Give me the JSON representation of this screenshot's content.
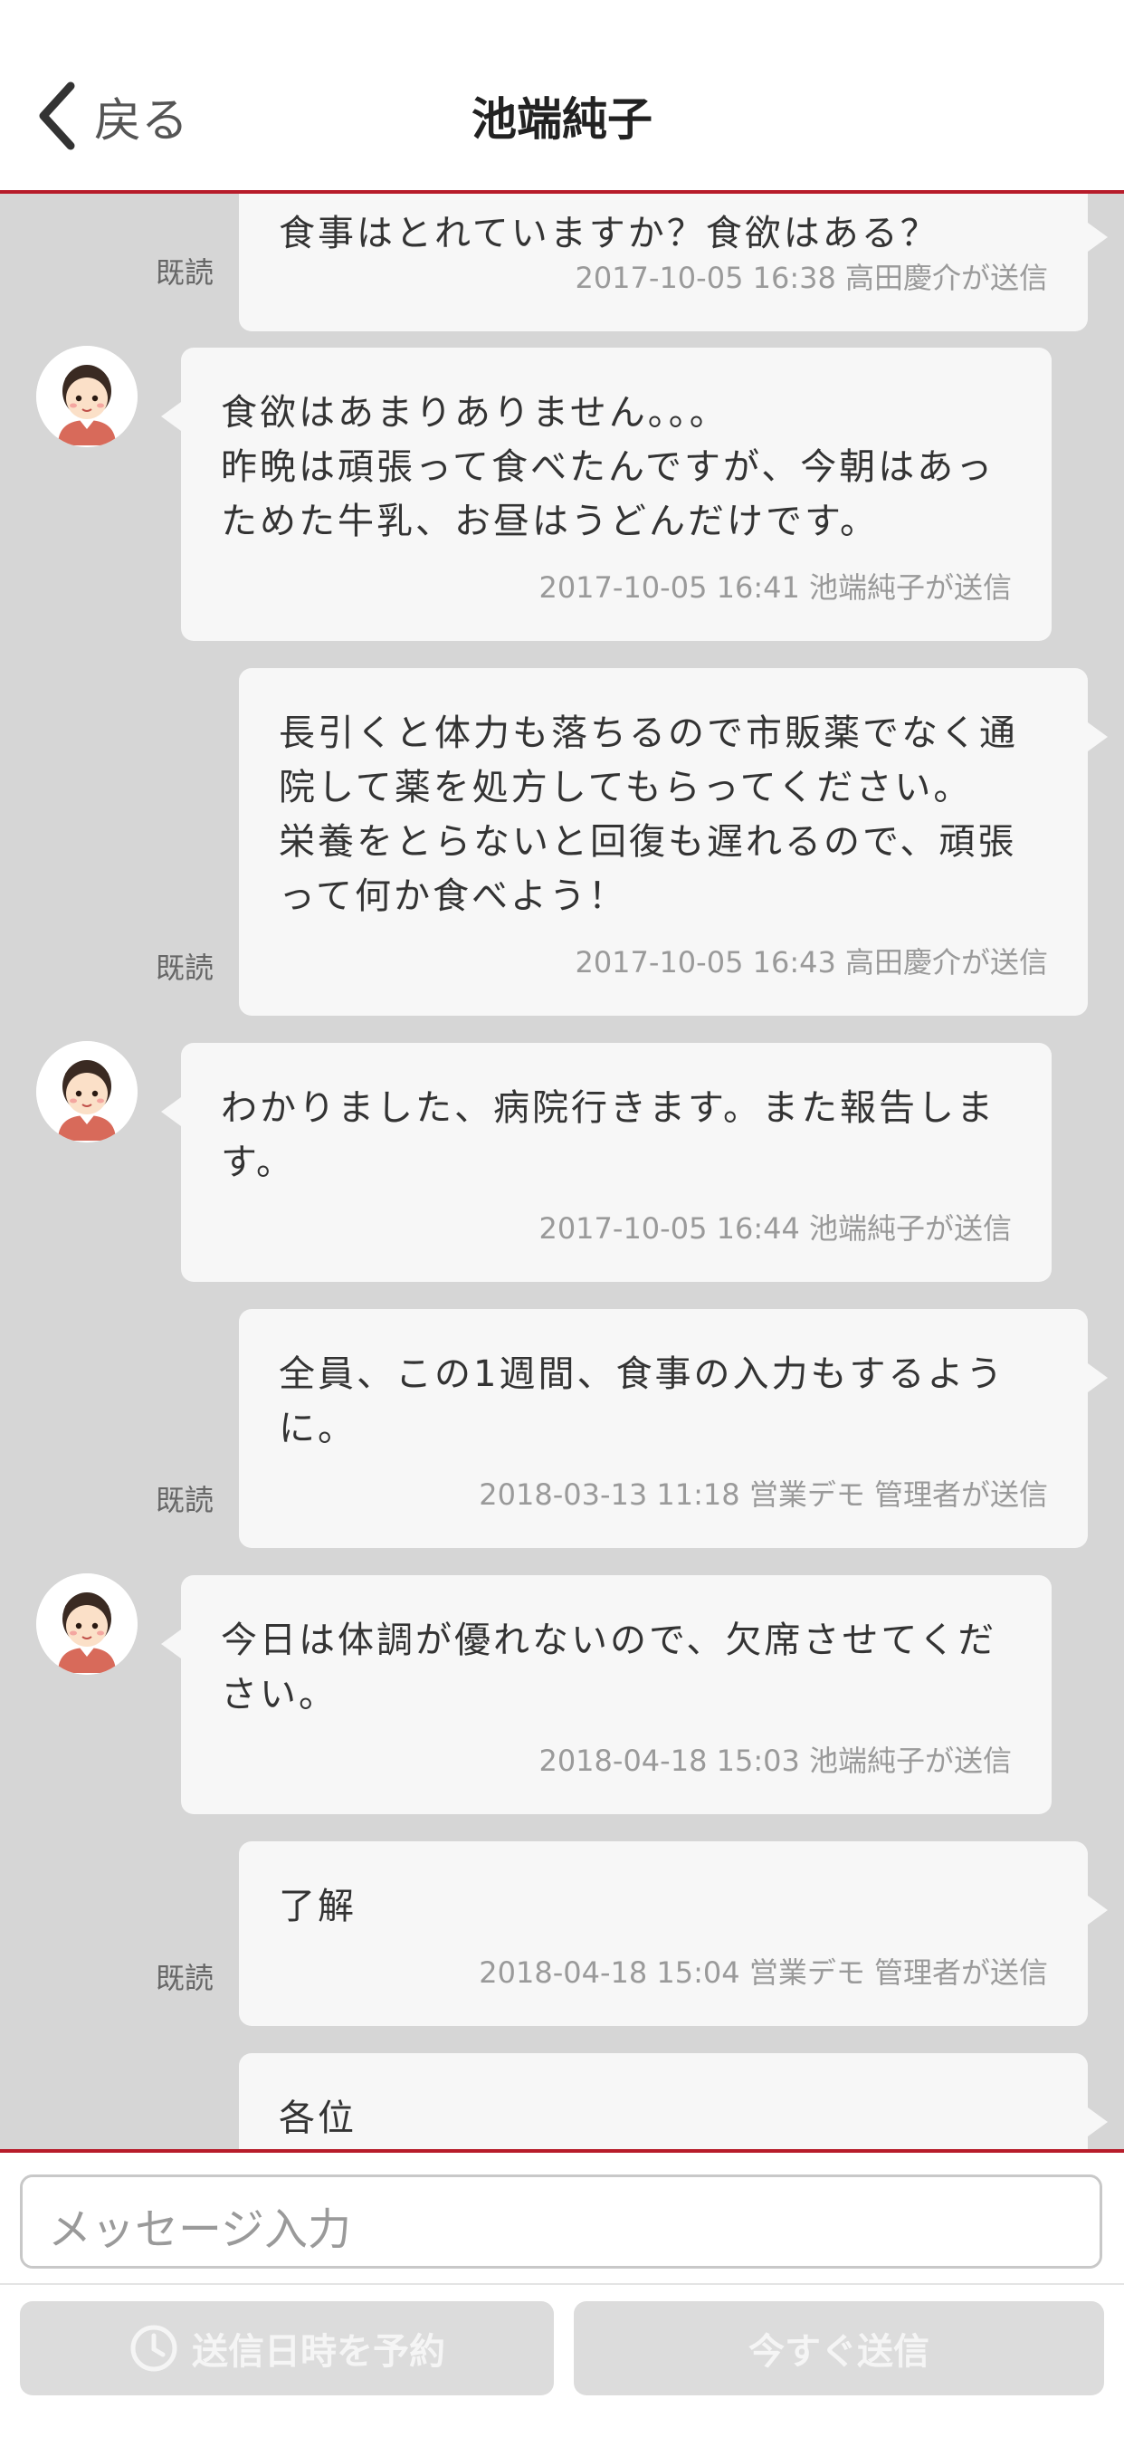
{
  "header": {
    "back_label": "戻る",
    "title": "池端純子"
  },
  "messages": [
    {
      "direction": "out",
      "text": "食事はとれていますか？食欲はある？",
      "meta": "2017-10-05 16:38 高田慶介が送信",
      "read": "既読"
    },
    {
      "direction": "in",
      "text": "食欲はあまりありません。。。\n昨晩は頑張って食べたんですが、今朝はあっためた牛乳、お昼はうどんだけです。",
      "meta": "2017-10-05 16:41 池端純子が送信"
    },
    {
      "direction": "out",
      "text": "長引くと体力も落ちるので市販薬でなく通院して薬を処方してもらってください。\n栄養をとらないと回復も遅れるので、頑張って何か食べよう！",
      "meta": "2017-10-05 16:43 高田慶介が送信",
      "read": "既読"
    },
    {
      "direction": "in",
      "text": "わかりました、病院行きます。また報告します。",
      "meta": "2017-10-05 16:44 池端純子が送信"
    },
    {
      "direction": "out",
      "text": "全員、この1週間、食事の入力もするように。",
      "meta": "2018-03-13 11:18 営業デモ 管理者が送信",
      "read": "既読"
    },
    {
      "direction": "in",
      "text": "今日は体調が優れないので、欠席させてください。",
      "meta": "2018-04-18 15:03 池端純子が送信"
    },
    {
      "direction": "out",
      "text": "了解",
      "meta": "2018-04-18 15:04 営業デモ 管理者が送信",
      "read": "既読"
    },
    {
      "direction": "out",
      "text": "各位",
      "meta": "",
      "read": ""
    }
  ],
  "composer": {
    "placeholder": "メッセージ入力",
    "schedule_label": "送信日時を予約",
    "send_now_label": "今すぐ送信"
  },
  "colors": {
    "accent": "#b71c2a",
    "chat_bg": "#d6d6d6",
    "bubble_bg": "#f7f7f7"
  },
  "icons": {
    "back": "chevron-left-icon",
    "schedule": "clock-icon",
    "avatar": "user-avatar-illustration"
  }
}
